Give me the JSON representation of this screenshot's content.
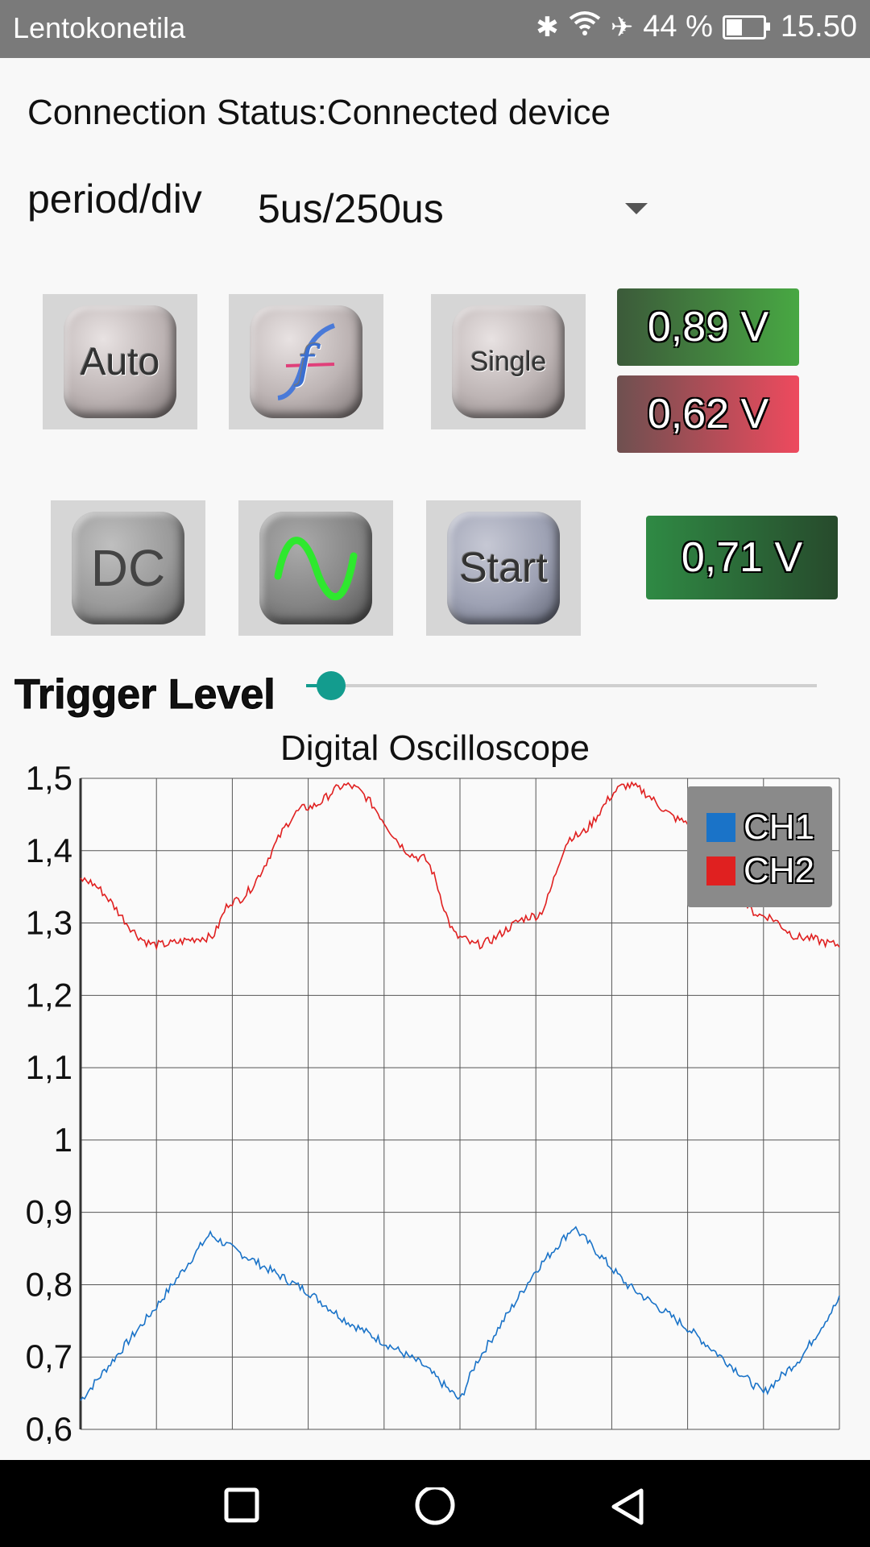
{
  "statusbar": {
    "mode_label": "Lentokonetila",
    "battery_percent": "44 %",
    "battery_level": 0.44,
    "time": "15.50",
    "icons": [
      "bluetooth-icon",
      "wifi-icon",
      "airplane-icon",
      "battery-icon"
    ]
  },
  "connection": {
    "text": "Connection Status:Connected device"
  },
  "period": {
    "label": "period/div",
    "selected": "5us/250us"
  },
  "buttons": {
    "auto": "Auto",
    "freq": "f",
    "single": "Single",
    "dc": "DC",
    "start": "Start"
  },
  "readouts": {
    "ch1": "0,89 V",
    "ch2": "0,62 V",
    "trigger": "0,71 V"
  },
  "trigger": {
    "label": "Trigger Level",
    "level": 0.04
  },
  "colors": {
    "accent": "#139c8e",
    "ch1": "#1a73c8",
    "ch2": "#e02020"
  },
  "chart_data": {
    "type": "line",
    "title": "Digital Oscilloscope",
    "xlabel": "",
    "ylabel": "",
    "ylim": [
      0.6,
      1.5
    ],
    "yticks": [
      "1,5",
      "1,4",
      "1,3",
      "1,2",
      "1,1",
      "1",
      "0,9",
      "0,8",
      "0,7",
      "0,6"
    ],
    "grid": true,
    "legend_position": "top-right",
    "x": [
      0,
      0.1,
      0.17,
      0.2,
      0.3,
      0.35,
      0.45,
      0.5,
      0.52,
      0.6,
      0.65,
      0.72,
      0.8,
      0.9,
      0.95,
      1.0
    ],
    "series": [
      {
        "name": "CH1",
        "color": "#1a73c8",
        "values": [
          0.64,
          0.77,
          0.87,
          0.85,
          0.79,
          0.75,
          0.69,
          0.64,
          0.69,
          0.82,
          0.88,
          0.8,
          0.74,
          0.65,
          0.7,
          0.78
        ]
      },
      {
        "name": "CH2",
        "color": "#e02020",
        "values": [
          1.36,
          1.27,
          1.28,
          1.33,
          1.46,
          1.49,
          1.39,
          1.28,
          1.27,
          1.31,
          1.42,
          1.49,
          1.44,
          1.31,
          1.28,
          1.27
        ]
      }
    ]
  },
  "navbar": {
    "icons": [
      "square-icon",
      "circle-icon",
      "triangle-back-icon"
    ]
  }
}
